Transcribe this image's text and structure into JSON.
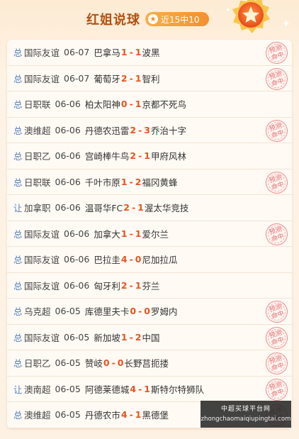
{
  "header": {
    "title": "红姐说球",
    "record": "近15中10",
    "medal_icon": "star-medal-icon"
  },
  "colors": {
    "accent": "#e8531f",
    "title": "#b3510f",
    "tag": "#4f7fbf",
    "stamp": "#e46a6a"
  },
  "stamp_label": "预测命中",
  "matches": [
    {
      "tag": "总",
      "league": "国际友谊",
      "date": "06-07",
      "home": "巴拿马",
      "home_score": "1",
      "away_score": "1",
      "away": "波黑",
      "hit": true
    },
    {
      "tag": "总",
      "league": "国际友谊",
      "date": "06-07",
      "home": "葡萄牙",
      "home_score": "2",
      "away_score": "1",
      "away": "智利",
      "hit": true
    },
    {
      "tag": "总",
      "league": "日职联",
      "date": "06-06",
      "home": "柏太阳神",
      "home_score": "0",
      "away_score": "1",
      "away": "京都不死鸟",
      "hit": false
    },
    {
      "tag": "总",
      "league": "澳维超",
      "date": "06-06",
      "home": "丹德农迅雷",
      "home_score": "2",
      "away_score": "3",
      "away": "乔治十字",
      "hit": true
    },
    {
      "tag": "总",
      "league": "日职乙",
      "date": "06-06",
      "home": "宫崎棒牛鸟",
      "home_score": "2",
      "away_score": "1",
      "away": "甲府风林",
      "hit": false
    },
    {
      "tag": "总",
      "league": "日职联",
      "date": "06-06",
      "home": "千叶市原",
      "home_score": "1",
      "away_score": "2",
      "away": "福冈黄蜂",
      "hit": true
    },
    {
      "tag": "让",
      "league": "加拿职",
      "date": "06-06",
      "home": "温哥华FC",
      "home_score": "2",
      "away_score": "1",
      "away": "渥太华竞技",
      "hit": false
    },
    {
      "tag": "总",
      "league": "国际友谊",
      "date": "06-06",
      "home": "加拿大",
      "home_score": "1",
      "away_score": "1",
      "away": "爱尔兰",
      "hit": true
    },
    {
      "tag": "总",
      "league": "国际友谊",
      "date": "06-06",
      "home": "巴拉圭",
      "home_score": "4",
      "away_score": "0",
      "away": "尼加拉瓜",
      "hit": false
    },
    {
      "tag": "总",
      "league": "国际友谊",
      "date": "06-06",
      "home": "匈牙利",
      "home_score": "2",
      "away_score": "1",
      "away": "芬兰",
      "hit": false
    },
    {
      "tag": "总",
      "league": "乌克超",
      "date": "06-05",
      "home": "库德里夫卡",
      "home_score": "0",
      "away_score": "0",
      "away": "罗姆内",
      "hit": true
    },
    {
      "tag": "总",
      "league": "国际友谊",
      "date": "06-05",
      "home": "新加坡",
      "home_score": "1",
      "away_score": "2",
      "away": "中国",
      "hit": true
    },
    {
      "tag": "总",
      "league": "日职乙",
      "date": "06-05",
      "home": "赞岐",
      "home_score": "0",
      "away_score": "0",
      "away": "长野莒扼搂",
      "hit": true
    },
    {
      "tag": "让",
      "league": "澳南超",
      "date": "06-05",
      "home": "阿德莱德城",
      "home_score": "4",
      "away_score": "1",
      "away": "斯特尔特狮队",
      "hit": true
    },
    {
      "tag": "总",
      "league": "澳维超",
      "date": "06-05",
      "home": "丹德农市",
      "home_score": "4",
      "away_score": "1",
      "away": "黑德堡",
      "hit": true
    }
  ],
  "watermark": {
    "top": "中超买球平台网",
    "url": "zhongchaomaiqiupingtai.com"
  }
}
